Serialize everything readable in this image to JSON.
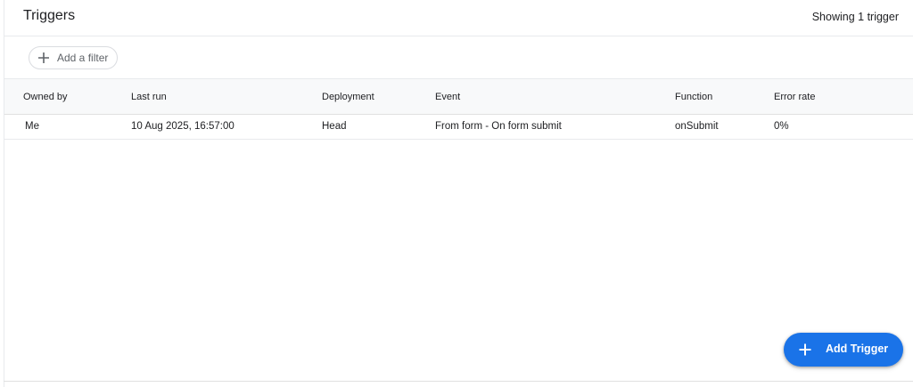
{
  "header": {
    "title": "Triggers",
    "count_text": "Showing 1 trigger"
  },
  "filter": {
    "add_label": "Add a filter",
    "icon": "plus-icon"
  },
  "table": {
    "columns": [
      "Owned by",
      "Last run",
      "Deployment",
      "Event",
      "Function",
      "Error rate"
    ],
    "rows": [
      [
        "Me",
        "10 Aug 2025, 16:57:00",
        "Head",
        "From form - On form submit",
        "onSubmit",
        "0%"
      ]
    ]
  },
  "fab": {
    "label": "Add Trigger",
    "icon": "plus-icon"
  },
  "colors": {
    "accent": "#1a73e8",
    "header_bg": "#f8f9fa",
    "border": "#e0e0e0"
  }
}
